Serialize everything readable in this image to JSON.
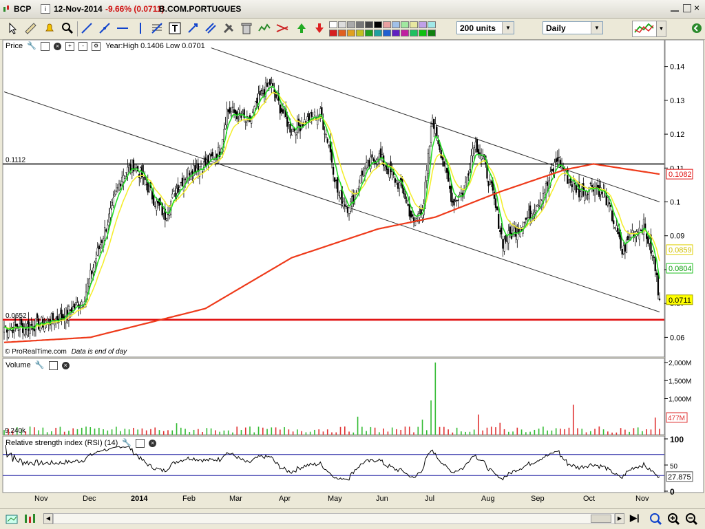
{
  "header": {
    "symbol": "BCP",
    "date": "12-Nov-2014",
    "change": "-9.66% (0.0711)",
    "name": "B.COM.PORTUGUES"
  },
  "toolbar": {
    "units_select": "200 units",
    "period_select": "Daily",
    "icons": [
      "cursor-icon",
      "ruler-icon",
      "alarm-icon",
      "zoom-icon",
      "line-icon",
      "trendline-icon",
      "horizontal-line-icon",
      "vertical-line-icon",
      "fibonacci-icon",
      "text-icon",
      "arrows-icon",
      "channel-icon",
      "tools-icon",
      "trash-icon",
      "pattern-icon",
      "pattern2-icon",
      "buy-arrow-icon",
      "sell-arrow-icon"
    ],
    "colors": {
      "green_up": "#33aa33",
      "red_down": "#dd2222"
    }
  },
  "price_panel": {
    "title": "Price",
    "info": "Year:High 0.1406 Low 0.0701",
    "footer": "© ProRealTime.com",
    "footer_note": "Data is end of day",
    "level_high_label": "0.1112",
    "level_low_label": "0.0652",
    "badges": {
      "ma200": "0.1082",
      "ma_yellow": "0.0859",
      "ma_green": "0.0804",
      "last": "0.0711"
    }
  },
  "volume_panel": {
    "title": "Volume",
    "ticks": [
      "2,000M",
      "1,500M",
      "1,000M"
    ],
    "last_badge": "477M",
    "min_label": "9,240k"
  },
  "rsi_panel": {
    "title": "Relative strength index (RSI) (14)",
    "ticks": [
      "100",
      "50",
      "0"
    ],
    "last_badge": "27.875"
  },
  "chart_data": {
    "type": "candlestick",
    "title": "BCP",
    "ylim": [
      0.055,
      0.145
    ],
    "yticks": [
      0.06,
      0.07,
      0.08,
      0.09,
      0.1,
      0.11,
      0.12,
      0.13,
      0.14
    ],
    "x_labels": [
      "Nov",
      "Dec",
      "2014",
      "Feb",
      "Mar",
      "Apr",
      "May",
      "Jun",
      "Jul",
      "Aug",
      "Sep",
      "Oct",
      "Nov"
    ],
    "close_anchors": [
      [
        0,
        0.063
      ],
      [
        12,
        0.063
      ],
      [
        25,
        0.064
      ],
      [
        40,
        0.066
      ],
      [
        55,
        0.071
      ],
      [
        65,
        0.085
      ],
      [
        75,
        0.098
      ],
      [
        82,
        0.108
      ],
      [
        90,
        0.111
      ],
      [
        97,
        0.107
      ],
      [
        105,
        0.1
      ],
      [
        112,
        0.096
      ],
      [
        120,
        0.104
      ],
      [
        130,
        0.11
      ],
      [
        140,
        0.111
      ],
      [
        150,
        0.115
      ],
      [
        155,
        0.127
      ],
      [
        162,
        0.126
      ],
      [
        170,
        0.123
      ],
      [
        178,
        0.131
      ],
      [
        185,
        0.135
      ],
      [
        192,
        0.128
      ],
      [
        200,
        0.121
      ],
      [
        210,
        0.124
      ],
      [
        220,
        0.126
      ],
      [
        226,
        0.117
      ],
      [
        232,
        0.103
      ],
      [
        240,
        0.098
      ],
      [
        250,
        0.109
      ],
      [
        260,
        0.114
      ],
      [
        268,
        0.109
      ],
      [
        278,
        0.103
      ],
      [
        285,
        0.093
      ],
      [
        292,
        0.1
      ],
      [
        298,
        0.125
      ],
      [
        305,
        0.113
      ],
      [
        312,
        0.1
      ],
      [
        320,
        0.103
      ],
      [
        327,
        0.118
      ],
      [
        333,
        0.113
      ],
      [
        340,
        0.102
      ],
      [
        347,
        0.088
      ],
      [
        354,
        0.091
      ],
      [
        362,
        0.094
      ],
      [
        370,
        0.099
      ],
      [
        378,
        0.105
      ],
      [
        385,
        0.113
      ],
      [
        392,
        0.107
      ],
      [
        400,
        0.103
      ],
      [
        410,
        0.105
      ],
      [
        418,
        0.102
      ],
      [
        425,
        0.093
      ],
      [
        430,
        0.085
      ],
      [
        437,
        0.091
      ],
      [
        445,
        0.093
      ],
      [
        452,
        0.083
      ],
      [
        456,
        0.0711
      ]
    ],
    "ma200_anchors": [
      [
        0,
        0.0585
      ],
      [
        60,
        0.06
      ],
      [
        140,
        0.0685
      ],
      [
        200,
        0.0835
      ],
      [
        260,
        0.092
      ],
      [
        300,
        0.0955
      ],
      [
        345,
        0.103
      ],
      [
        390,
        0.1095
      ],
      [
        410,
        0.1112
      ],
      [
        456,
        0.1082
      ]
    ],
    "level_high": 0.1112,
    "level_low": 0.0652,
    "channel_lines": [
      {
        "x1": 0,
        "y1": 0.1325,
        "x2": 456,
        "y2": 0.0675
      },
      {
        "x1": 144,
        "y1": 0.1455,
        "x2": 456,
        "y2": 0.1
      }
    ],
    "volume": {
      "ylim": [
        0,
        2000
      ],
      "spike_positions": [
        0,
        40,
        120,
        245,
        290,
        298,
        300,
        330,
        345,
        395,
        454
      ],
      "spike_values": [
        130,
        220,
        320,
        500,
        420,
        950,
        2000,
        560,
        330,
        830,
        477
      ]
    },
    "rsi": {
      "ylim": [
        0,
        100
      ],
      "levels": [
        30,
        70
      ],
      "last": 27.875
    }
  }
}
